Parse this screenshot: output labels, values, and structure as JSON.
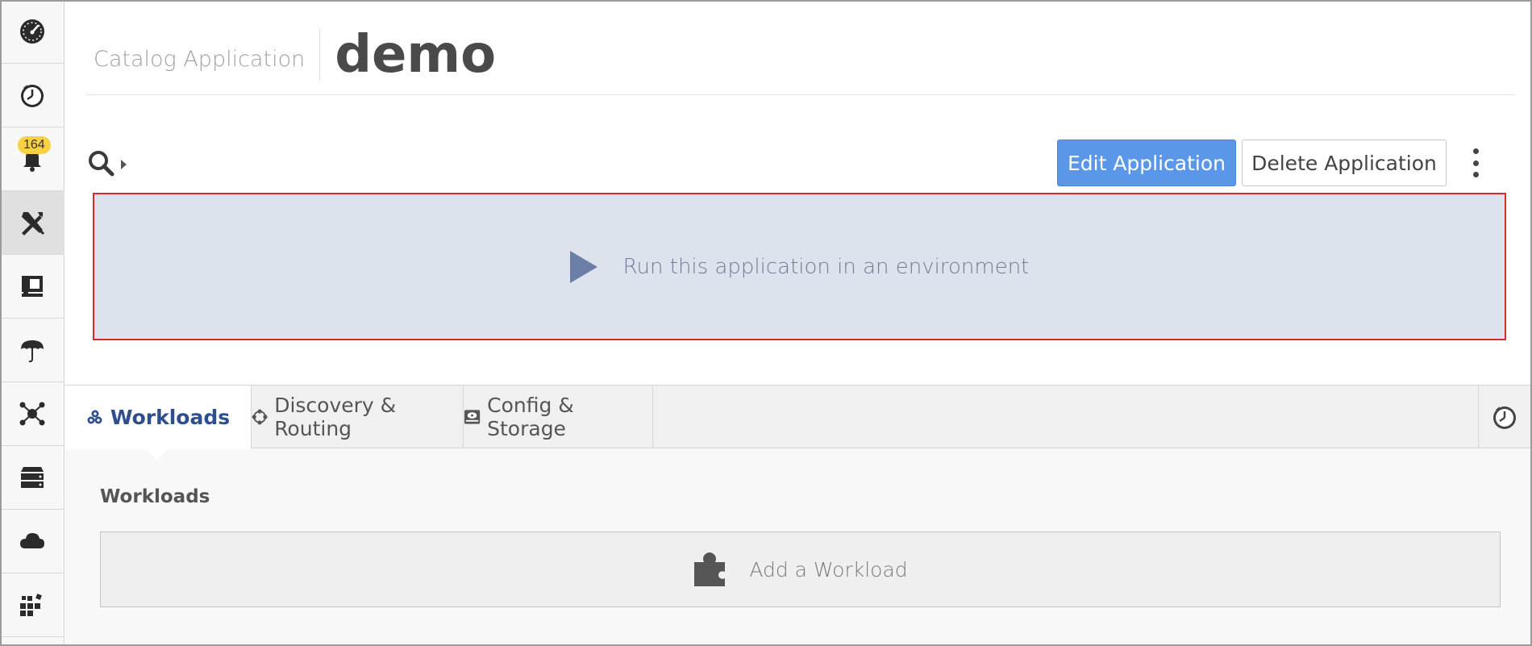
{
  "sidebar": {
    "items": [
      {
        "name": "dashboard",
        "icon": "speedometer-icon"
      },
      {
        "name": "recent",
        "icon": "clock-icon"
      },
      {
        "name": "alerts",
        "icon": "bell-icon",
        "badge": "164"
      },
      {
        "name": "apps",
        "icon": "tools-icon",
        "active": true
      },
      {
        "name": "workspaces",
        "icon": "monitor-icon"
      },
      {
        "name": "umbrella",
        "icon": "umbrella-icon"
      },
      {
        "name": "network",
        "icon": "network-icon"
      },
      {
        "name": "storage",
        "icon": "server-stack-icon"
      },
      {
        "name": "cloud",
        "icon": "cloud-icon"
      },
      {
        "name": "registry",
        "icon": "blocks-icon"
      }
    ]
  },
  "header": {
    "crumb": "Catalog Application",
    "title": "demo"
  },
  "toolbar": {
    "edit_label": "Edit Application",
    "delete_label": "Delete Application"
  },
  "run_banner": {
    "label": "Run this application in an environment"
  },
  "tabs": [
    {
      "label": "Workloads",
      "icon": "cubes-icon",
      "active": true
    },
    {
      "label": "Discovery & Routing",
      "icon": "circle-nodes-icon"
    },
    {
      "label": "Config & Storage",
      "icon": "hdd-icon"
    }
  ],
  "workloads": {
    "section_title": "Workloads",
    "add_label": "Add a Workload"
  },
  "colors": {
    "primary": "#5b97e8",
    "banner_bg": "#dde3ec",
    "banner_border": "#d52b2b",
    "active_tab_text": "#2d4f8e",
    "badge": "#f7d046"
  }
}
